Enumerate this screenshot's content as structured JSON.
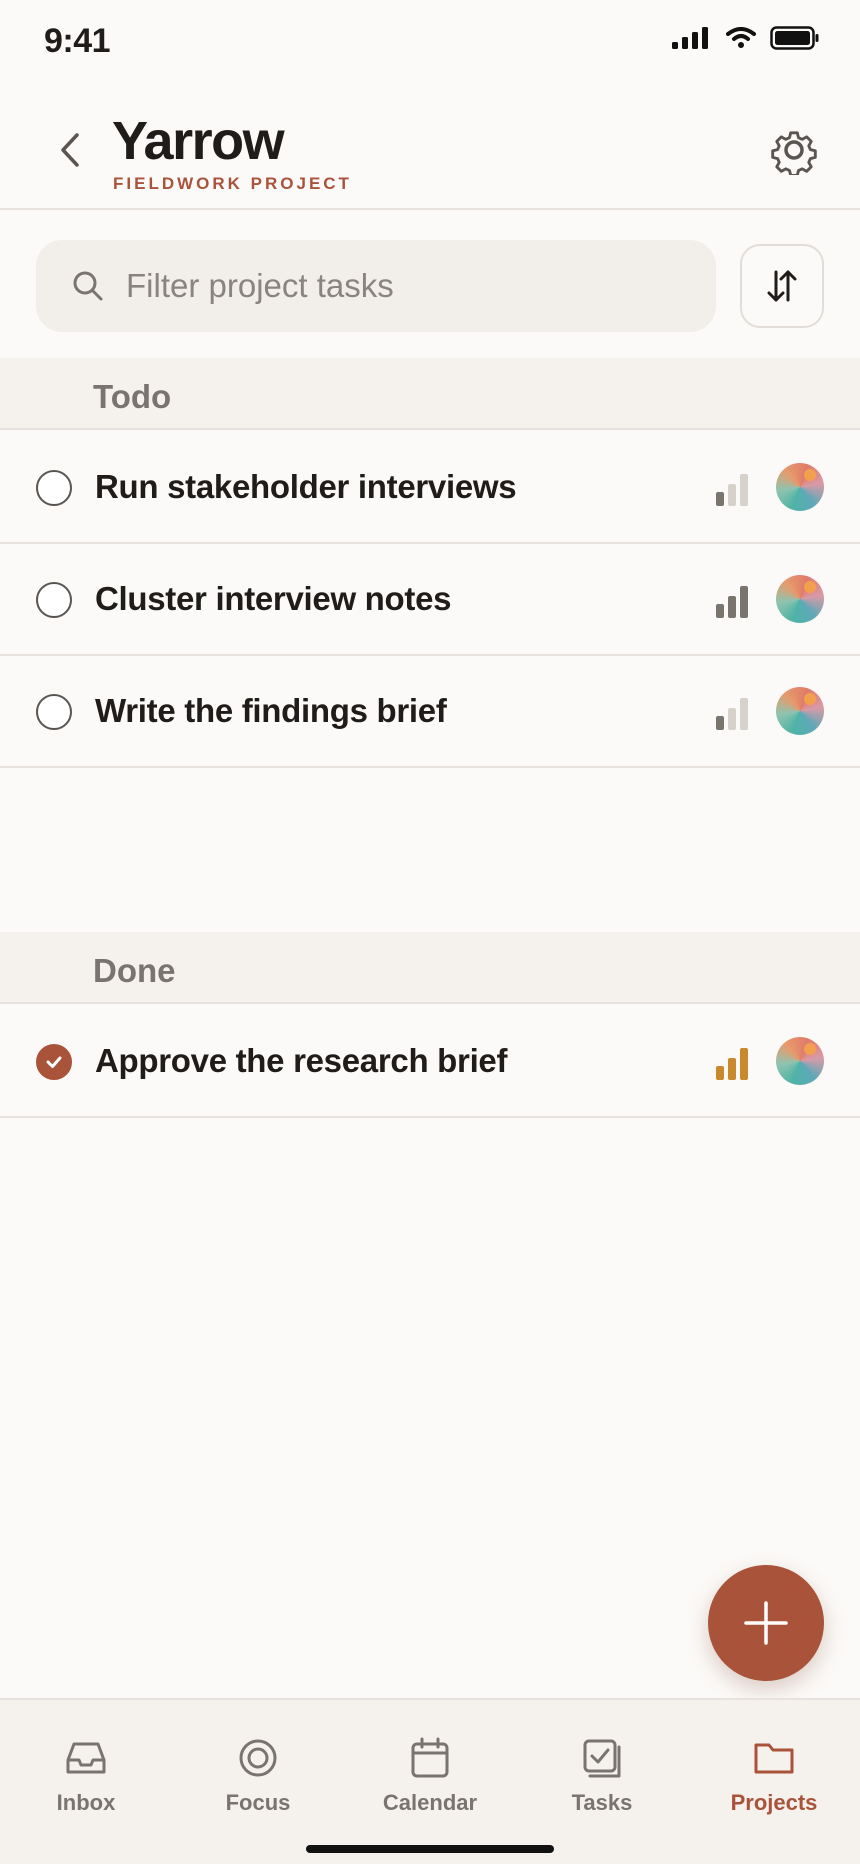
{
  "status_bar": {
    "time": "9:41"
  },
  "header": {
    "title": "Yarrow",
    "subtitle": "FIELDWORK PROJECT"
  },
  "search": {
    "placeholder": "Filter project tasks",
    "value": ""
  },
  "sections": {
    "todo": {
      "title": "Todo",
      "tasks": [
        {
          "title": "Run stakeholder interviews",
          "done": false,
          "priority_level": 1
        },
        {
          "title": "Cluster interview notes",
          "done": false,
          "priority_level": 3
        },
        {
          "title": "Write the findings brief",
          "done": false,
          "priority_level": 1
        }
      ]
    },
    "done": {
      "title": "Done",
      "tasks": [
        {
          "title": "Approve the research brief",
          "done": true,
          "priority_level": 3
        }
      ]
    }
  },
  "tab_bar": {
    "tabs": [
      {
        "label": "Inbox",
        "icon": "inbox-icon",
        "active": false
      },
      {
        "label": "Focus",
        "icon": "target-icon",
        "active": false
      },
      {
        "label": "Calendar",
        "icon": "calendar-icon",
        "active": false
      },
      {
        "label": "Tasks",
        "icon": "tasks-icon",
        "active": false
      },
      {
        "label": "Projects",
        "icon": "folder-icon",
        "active": true
      }
    ]
  },
  "colors": {
    "accent": "#a9533a",
    "priority_high": "#c98a2e",
    "priority_neutral": "#7a746e",
    "priority_empty": "#d6d1cb",
    "background": "#fcfaf8",
    "section_background": "#f5f1ec"
  }
}
